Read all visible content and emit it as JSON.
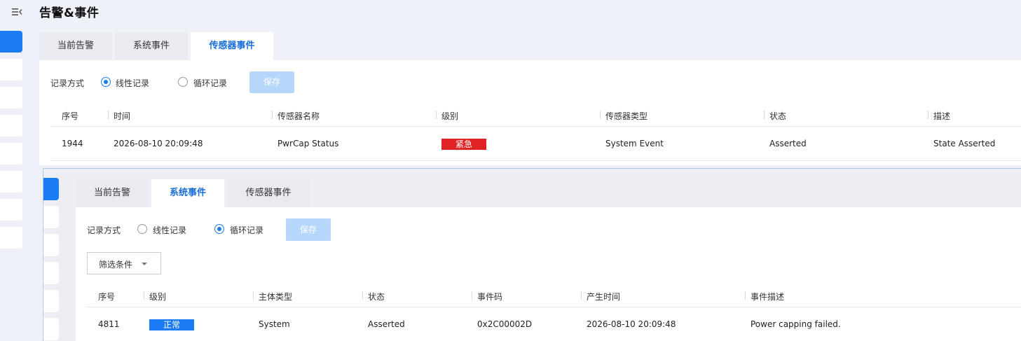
{
  "page": {
    "title": "告警&事件"
  },
  "colors": {
    "accent": "#1a7cf4",
    "urgent": "#e02424",
    "normal": "#1a7cf4"
  },
  "back": {
    "tabs": [
      "当前告警",
      "系统事件",
      "传感器事件"
    ],
    "active_tab": "传感器事件",
    "record_mode_label": "记录方式",
    "options": [
      "线性记录",
      "循环记录"
    ],
    "selected_option": "线性记录",
    "save_label": "保存",
    "columns": [
      "序号",
      "时间",
      "传感器名称",
      "级别",
      "传感器类型",
      "状态",
      "描述"
    ],
    "rows": [
      {
        "id": "1944",
        "time": "2026-08-10 20:09:48",
        "sensor_name": "PwrCap Status",
        "level": "紧急",
        "sensor_type": "System Event",
        "status": "Asserted",
        "description": "State Asserted"
      }
    ]
  },
  "front": {
    "tabs": [
      "当前告警",
      "系统事件",
      "传感器事件"
    ],
    "active_tab": "系统事件",
    "record_mode_label": "记录方式",
    "options": [
      "线性记录",
      "循环记录"
    ],
    "selected_option": "循环记录",
    "save_label": "保存",
    "filter_label": "筛选条件",
    "columns": [
      "序号",
      "级别",
      "主体类型",
      "状态",
      "事件码",
      "产生时间",
      "事件描述"
    ],
    "rows": [
      {
        "id": "4811",
        "level": "正常",
        "subject_type": "System",
        "status": "Asserted",
        "event_code": "0x2C00002D",
        "time": "2026-08-10 20:09:48",
        "description": "Power capping failed."
      }
    ]
  }
}
